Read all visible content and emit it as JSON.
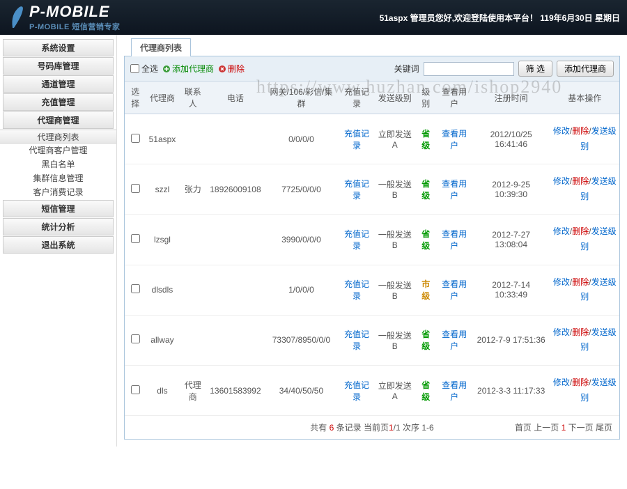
{
  "header": {
    "logo_title": "P-MOBILE",
    "logo_sub": "P-MOBILE 短信营销专家",
    "welcome": "51aspx 管理员您好,欢迎登陆使用本平台！  119年6月30日 星期日"
  },
  "watermark": "https://www.huzhan.com/ishop2940",
  "sidebar": {
    "items": [
      {
        "label": "系统设置"
      },
      {
        "label": "号码库管理"
      },
      {
        "label": "通道管理"
      },
      {
        "label": "充值管理"
      },
      {
        "label": "代理商管理"
      }
    ],
    "submenu": [
      {
        "label": "代理商列表"
      },
      {
        "label": "代理商客户管理"
      },
      {
        "label": "黑白名单"
      },
      {
        "label": "集群信息管理"
      },
      {
        "label": "客户消费记录"
      }
    ],
    "items2": [
      {
        "label": "短信管理"
      },
      {
        "label": "统计分析"
      },
      {
        "label": "退出系统"
      }
    ]
  },
  "panel": {
    "title": "代理商列表"
  },
  "toolbar": {
    "select_all": "全选",
    "add_agent": "添加代理商",
    "delete": "删除",
    "keyword_label": "关键词",
    "keyword_value": "",
    "filter_btn": "筛 选",
    "add_btn": "添加代理商"
  },
  "table": {
    "headers": [
      "选择",
      "代理商",
      "联系人",
      "电话",
      "网关/106/彩信/集群",
      "充值记录",
      "发送级别",
      "级别",
      "查看用户",
      "注册时间",
      "基本操作"
    ],
    "rows": [
      {
        "agent": "51aspx",
        "contact": "",
        "phone": "",
        "gateway": "0/0/0/0",
        "recharge": "充值记录",
        "sendlevel": "立即发送A",
        "level": "省级",
        "levelClass": "green",
        "viewuser": "查看用户",
        "regtime": "2012/10/25 16:41:46"
      },
      {
        "agent": "szzl",
        "contact": "张力",
        "phone": "18926009108",
        "gateway": "7725/0/0/0",
        "recharge": "充值记录",
        "sendlevel": "一般发送B",
        "level": "省级",
        "levelClass": "green",
        "viewuser": "查看用户",
        "regtime": "2012-9-25 10:39:30"
      },
      {
        "agent": "lzsgl",
        "contact": "",
        "phone": "",
        "gateway": "3990/0/0/0",
        "recharge": "充值记录",
        "sendlevel": "一般发送B",
        "level": "省级",
        "levelClass": "green",
        "viewuser": "查看用户",
        "regtime": "2012-7-27 13:08:04"
      },
      {
        "agent": "dlsdls",
        "contact": "",
        "phone": "",
        "gateway": "1/0/0/0",
        "recharge": "充值记录",
        "sendlevel": "一般发送B",
        "level": "市级",
        "levelClass": "orange",
        "viewuser": "查看用户",
        "regtime": "2012-7-14 10:33:49"
      },
      {
        "agent": "allway",
        "contact": "",
        "phone": "",
        "gateway": "73307/8950/0/0",
        "recharge": "充值记录",
        "sendlevel": "一般发送B",
        "level": "省级",
        "levelClass": "green",
        "viewuser": "查看用户",
        "regtime": "2012-7-9 17:51:36"
      },
      {
        "agent": "dls",
        "contact": "代理商",
        "phone": "13601583992",
        "gateway": "34/40/50/50",
        "recharge": "充值记录",
        "sendlevel": "立即发送A",
        "level": "省级",
        "levelClass": "green",
        "viewuser": "查看用户",
        "regtime": "2012-3-3 11:17:33"
      }
    ],
    "ops": {
      "modify": "修改",
      "delete": "删除",
      "sendlevel": "发送级别"
    }
  },
  "pager": {
    "prefix": "共有 ",
    "count": "6",
    "mid1": " 条记录  当前页",
    "page_cur": "1",
    "mid2": "/1 次序 1-6",
    "first": "首页",
    "prev": "上一页",
    "page": "1",
    "next": "下一页",
    "last": "尾页"
  }
}
